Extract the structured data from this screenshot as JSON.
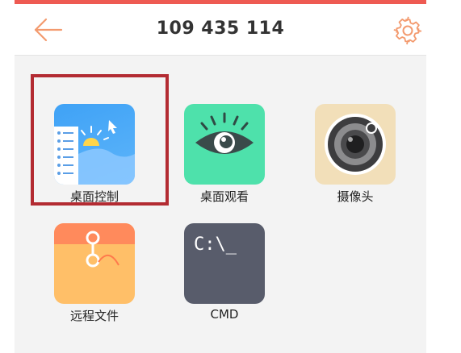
{
  "header": {
    "title": "109 435 114",
    "back_icon": "arrow-left-icon",
    "settings_icon": "gear-icon"
  },
  "tiles": [
    {
      "label": "桌面控制",
      "icon": "desktop-control-icon",
      "selected": true
    },
    {
      "label": "桌面观看",
      "icon": "eye-icon"
    },
    {
      "label": "摄像头",
      "icon": "camera-lens-icon"
    },
    {
      "label": "远程文件",
      "icon": "envelope-file-icon"
    },
    {
      "label": "CMD",
      "icon": "terminal-icon",
      "icon_text": "C:\\_"
    }
  ],
  "colors": {
    "accent": "#ee5a52",
    "selection_border": "#b32b32",
    "background": "#f3f3f3"
  }
}
